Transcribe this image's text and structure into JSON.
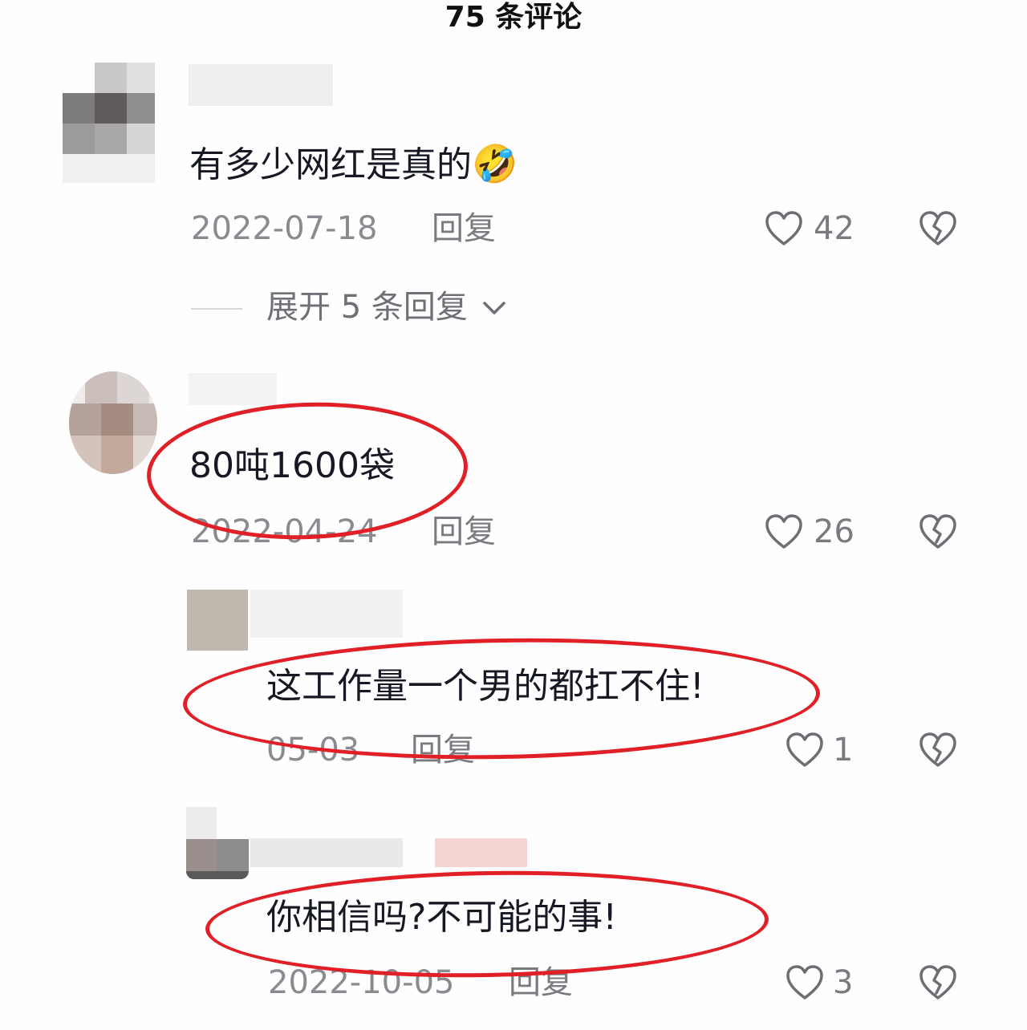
{
  "header": {
    "title": "75 条评论"
  },
  "comments": [
    {
      "text": "有多少网红是真的",
      "emoji": "🤣",
      "date": "2022-07-18",
      "reply_label": "回复",
      "likes": "42"
    },
    {
      "text": "80吨1600袋",
      "date": "2022-04-24",
      "reply_label": "回复",
      "likes": "26"
    }
  ],
  "expand": {
    "label": "展开 5 条回复"
  },
  "replies": [
    {
      "text": "这工作量一个男的都扛不住!",
      "date": "05-03",
      "reply_label": "回复",
      "likes": "1"
    },
    {
      "text": "你相信吗?不可能的事!",
      "date": "2022-10-05",
      "reply_label": "回复",
      "likes": "3"
    }
  ],
  "colors": {
    "highlight": "#e11f26",
    "text": "#161823",
    "meta": "#8a8b91"
  },
  "icons": [
    "heart-outline-icon",
    "broken-heart-icon",
    "chevron-down-icon"
  ]
}
